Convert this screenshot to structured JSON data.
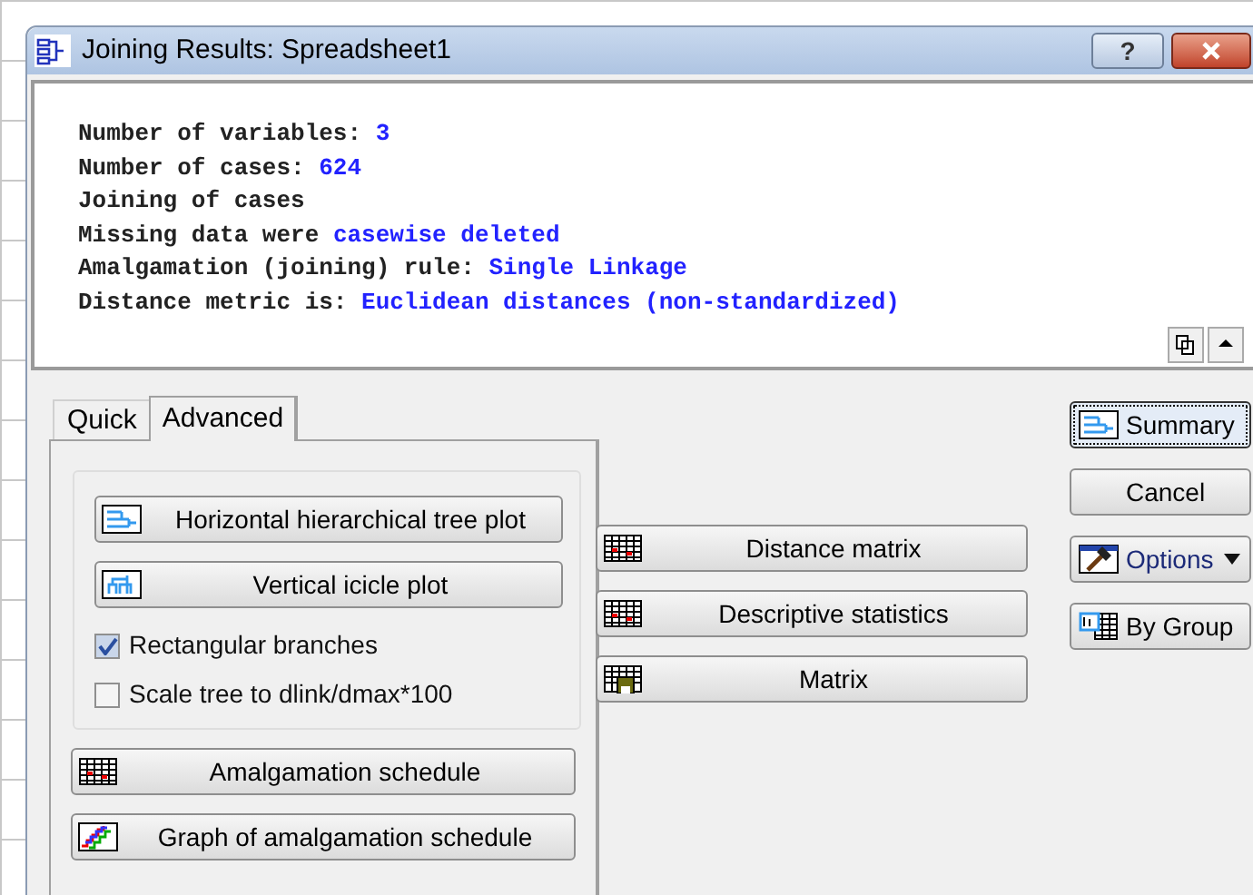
{
  "window": {
    "title": "Joining Results: Spreadsheet1",
    "help_button": "?"
  },
  "summary_lines": [
    {
      "segments": [
        {
          "text": "Number of variables: ",
          "kind": "label"
        },
        {
          "text": "3",
          "kind": "value"
        }
      ]
    },
    {
      "segments": [
        {
          "text": "Number of cases: ",
          "kind": "label"
        },
        {
          "text": "624",
          "kind": "value"
        }
      ]
    },
    {
      "segments": [
        {
          "text": "Joining of cases",
          "kind": "label"
        }
      ]
    },
    {
      "segments": [
        {
          "text": "Missing data were ",
          "kind": "label"
        },
        {
          "text": "casewise deleted",
          "kind": "value"
        }
      ]
    },
    {
      "segments": [
        {
          "text": "Amalgamation (joining) rule: ",
          "kind": "label"
        },
        {
          "text": "Single Linkage",
          "kind": "value"
        }
      ]
    },
    {
      "segments": [
        {
          "text": "Distance metric is: ",
          "kind": "label"
        },
        {
          "text": "Euclidean distances (non-standardized)",
          "kind": "value"
        }
      ]
    }
  ],
  "tabs": [
    {
      "label": "Quick",
      "selected": false
    },
    {
      "label": "Advanced",
      "selected": true
    }
  ],
  "plot_buttons": [
    {
      "label": "Horizontal hierarchical tree plot",
      "kind": "tree"
    },
    {
      "label": "Vertical icicle plot",
      "kind": "icicle"
    }
  ],
  "checkboxes": [
    {
      "label": "Rectangular branches",
      "checked": true
    },
    {
      "label": "Scale tree to dlink/dmax*100",
      "checked": false
    }
  ],
  "schedule_buttons": [
    {
      "label": "Amalgamation schedule",
      "kind": "grid"
    },
    {
      "label": "Graph of amalgamation schedule",
      "kind": "graph"
    }
  ],
  "matrix_buttons": [
    {
      "label": "Distance matrix",
      "kind": "grid"
    },
    {
      "label": "Descriptive statistics",
      "kind": "grid"
    },
    {
      "label": "Matrix",
      "kind": "gridsave"
    }
  ],
  "side_buttons": [
    {
      "label": "Summary",
      "kind": "tree",
      "focused": true,
      "dropdown": false
    },
    {
      "label": "Cancel",
      "kind": "plain",
      "focused": false,
      "dropdown": false
    },
    {
      "label": "Options",
      "kind": "hammer",
      "focused": false,
      "dropdown": true
    },
    {
      "label": "By Group",
      "kind": "bygroup",
      "focused": false,
      "dropdown": false
    }
  ]
}
